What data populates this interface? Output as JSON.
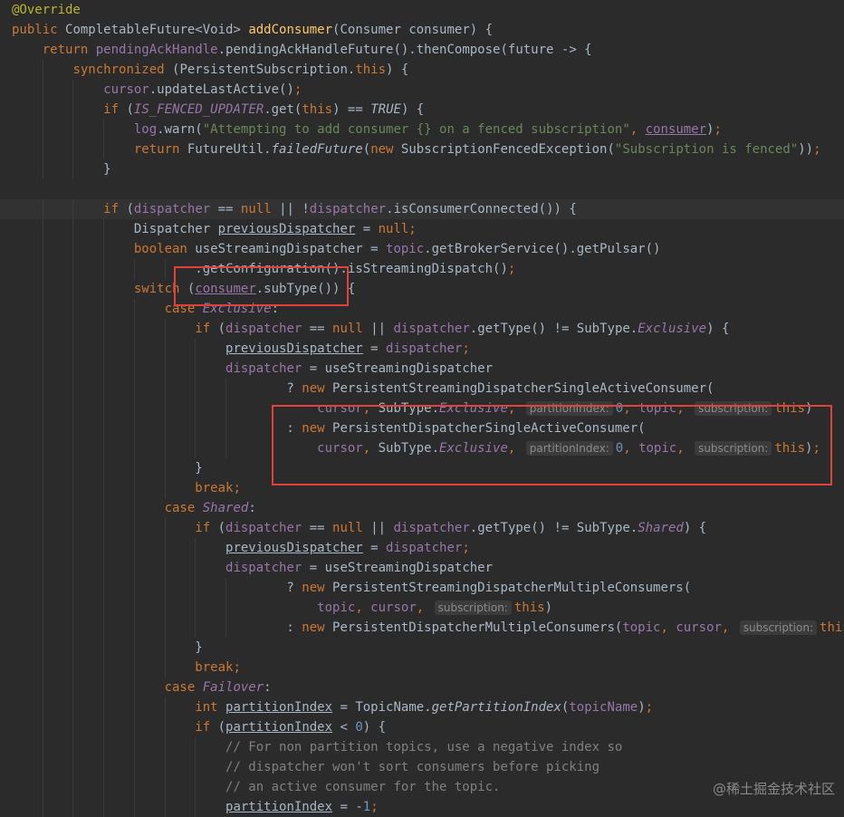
{
  "code_lines": [
    [
      [
        "t-ann",
        "@Override"
      ]
    ],
    [
      [
        "t-kw",
        "public "
      ],
      [
        "tok",
        "CompletableFuture<Void> "
      ],
      [
        "t-fn",
        "addConsumer"
      ],
      [
        "tok",
        "(Consumer consumer) {"
      ]
    ],
    [
      [
        "tok",
        "    "
      ],
      [
        "t-kw",
        "return "
      ],
      [
        "t-field",
        "pendingAckHandle"
      ],
      [
        "tok",
        ".pendingAckHandleFuture().thenCompose(future -> {"
      ]
    ],
    [
      [
        "tok",
        "        "
      ],
      [
        "t-kw",
        "synchronized "
      ],
      [
        "tok",
        "(PersistentSubscription."
      ],
      [
        "t-kw",
        "this"
      ],
      [
        "tok",
        ") {"
      ]
    ],
    [
      [
        "tok",
        "            "
      ],
      [
        "t-field",
        "cursor"
      ],
      [
        "tok",
        ".updateLastActive()"
      ],
      [
        "t-kw",
        ";"
      ]
    ],
    [
      [
        "tok",
        "            "
      ],
      [
        "t-kw",
        "if "
      ],
      [
        "tok",
        "("
      ],
      [
        "t-sfield",
        "IS_FENCED_UPDATER"
      ],
      [
        "tok",
        ".get("
      ],
      [
        "t-kw",
        "this"
      ],
      [
        "tok",
        ") == "
      ],
      [
        "t-italic",
        "TRUE"
      ],
      [
        "tok",
        ") {"
      ]
    ],
    [
      [
        "tok",
        "                "
      ],
      [
        "t-field",
        "log"
      ],
      [
        "tok",
        ".warn("
      ],
      [
        "t-str",
        "\"Attempting to add consumer {} on a fenced subscription\""
      ],
      [
        "t-kw",
        ", "
      ],
      [
        "t-ulf",
        "consumer"
      ],
      [
        "tok",
        ")"
      ],
      [
        "t-kw",
        ";"
      ]
    ],
    [
      [
        "tok",
        "                "
      ],
      [
        "t-kw",
        "return "
      ],
      [
        "tok",
        "FutureUtil."
      ],
      [
        "t-italic",
        "failedFuture"
      ],
      [
        "tok",
        "("
      ],
      [
        "t-kw",
        "new "
      ],
      [
        "tok",
        "SubscriptionFencedException("
      ],
      [
        "t-str",
        "\"Subscription is fenced\""
      ],
      [
        "tok",
        "))"
      ],
      [
        "t-kw",
        ";"
      ]
    ],
    [
      [
        "tok",
        "            }"
      ]
    ],
    [],
    [
      [
        "tok",
        "            "
      ],
      [
        "t-kw",
        "if "
      ],
      [
        "tok",
        "("
      ],
      [
        "t-field",
        "dispatcher"
      ],
      [
        "tok",
        " == "
      ],
      [
        "t-kw",
        "null "
      ],
      [
        "tok",
        "|| !"
      ],
      [
        "t-field",
        "dispatcher"
      ],
      [
        "tok",
        ".isConsumerConnected()) {"
      ]
    ],
    [
      [
        "tok",
        "                Dispatcher "
      ],
      [
        "t-ul",
        "previousDispatcher"
      ],
      [
        "tok",
        " = "
      ],
      [
        "t-kw",
        "null;"
      ]
    ],
    [
      [
        "tok",
        "                "
      ],
      [
        "t-kw",
        "boolean "
      ],
      [
        "tok",
        "useStreamingDispatcher = "
      ],
      [
        "t-field",
        "topic"
      ],
      [
        "tok",
        ".getBrokerService().getPulsar()"
      ]
    ],
    [
      [
        "tok",
        "                        .getConfiguration().isStreamingDispatch()"
      ],
      [
        "t-kw",
        ";"
      ]
    ],
    [
      [
        "tok",
        "                "
      ],
      [
        "t-kw",
        "switch "
      ],
      [
        "tok",
        "("
      ],
      [
        "t-ulf",
        "consumer"
      ],
      [
        "tok",
        ".subType()) {"
      ]
    ],
    [
      [
        "tok",
        "                    "
      ],
      [
        "t-kw",
        "case "
      ],
      [
        "t-enum",
        "Exclusive"
      ],
      [
        "tok",
        ":"
      ]
    ],
    [
      [
        "tok",
        "                        "
      ],
      [
        "t-kw",
        "if "
      ],
      [
        "tok",
        "("
      ],
      [
        "t-field",
        "dispatcher"
      ],
      [
        "tok",
        " == "
      ],
      [
        "t-kw",
        "null "
      ],
      [
        "tok",
        "|| "
      ],
      [
        "t-field",
        "dispatcher"
      ],
      [
        "tok",
        ".getType() != SubType."
      ],
      [
        "t-enum",
        "Exclusive"
      ],
      [
        "tok",
        ") {"
      ]
    ],
    [
      [
        "tok",
        "                            "
      ],
      [
        "t-ul",
        "previousDispatcher"
      ],
      [
        "tok",
        " = "
      ],
      [
        "t-field",
        "dispatcher"
      ],
      [
        "t-kw",
        ";"
      ]
    ],
    [
      [
        "tok",
        "                            "
      ],
      [
        "t-field",
        "dispatcher"
      ],
      [
        "tok",
        " = useStreamingDispatcher"
      ]
    ],
    [
      [
        "tok",
        "                                    ? "
      ],
      [
        "t-kw",
        "new "
      ],
      [
        "tok",
        "PersistentStreamingDispatcherSingleActiveConsumer("
      ]
    ],
    [
      [
        "tok",
        "                                        "
      ],
      [
        "t-field",
        "cursor"
      ],
      [
        "t-kw",
        ", "
      ],
      [
        "tok",
        "SubType."
      ],
      [
        "t-enum",
        "Exclusive"
      ],
      [
        "t-kw",
        ", "
      ],
      [
        "t-hint",
        "partitionIndex:"
      ],
      [
        "t-num",
        "0"
      ],
      [
        "t-kw",
        ", "
      ],
      [
        "t-field",
        "topic"
      ],
      [
        "t-kw",
        ", "
      ],
      [
        "t-hint",
        "subscription:"
      ],
      [
        "t-kw",
        "this"
      ],
      [
        "tok",
        ")"
      ]
    ],
    [
      [
        "tok",
        "                                    : "
      ],
      [
        "t-kw",
        "new "
      ],
      [
        "tok",
        "PersistentDispatcherSingleActiveConsumer("
      ]
    ],
    [
      [
        "tok",
        "                                        "
      ],
      [
        "t-field",
        "cursor"
      ],
      [
        "t-kw",
        ", "
      ],
      [
        "tok",
        "SubType."
      ],
      [
        "t-enum",
        "Exclusive"
      ],
      [
        "t-kw",
        ", "
      ],
      [
        "t-hint",
        "partitionIndex:"
      ],
      [
        "t-num",
        "0"
      ],
      [
        "t-kw",
        ", "
      ],
      [
        "t-field",
        "topic"
      ],
      [
        "t-kw",
        ", "
      ],
      [
        "t-hint",
        "subscription:"
      ],
      [
        "t-kw",
        "this"
      ],
      [
        "tok",
        ")"
      ],
      [
        "t-kw",
        ";"
      ]
    ],
    [
      [
        "tok",
        "                        }"
      ]
    ],
    [
      [
        "tok",
        "                        "
      ],
      [
        "t-kw",
        "break;"
      ]
    ],
    [
      [
        "tok",
        "                    "
      ],
      [
        "t-kw",
        "case "
      ],
      [
        "t-enum",
        "Shared"
      ],
      [
        "tok",
        ":"
      ]
    ],
    [
      [
        "tok",
        "                        "
      ],
      [
        "t-kw",
        "if "
      ],
      [
        "tok",
        "("
      ],
      [
        "t-field",
        "dispatcher"
      ],
      [
        "tok",
        " == "
      ],
      [
        "t-kw",
        "null "
      ],
      [
        "tok",
        "|| "
      ],
      [
        "t-field",
        "dispatcher"
      ],
      [
        "tok",
        ".getType() != SubType."
      ],
      [
        "t-enum",
        "Shared"
      ],
      [
        "tok",
        ") {"
      ]
    ],
    [
      [
        "tok",
        "                            "
      ],
      [
        "t-ul",
        "previousDispatcher"
      ],
      [
        "tok",
        " = "
      ],
      [
        "t-field",
        "dispatcher"
      ],
      [
        "t-kw",
        ";"
      ]
    ],
    [
      [
        "tok",
        "                            "
      ],
      [
        "t-field",
        "dispatcher"
      ],
      [
        "tok",
        " = useStreamingDispatcher"
      ]
    ],
    [
      [
        "tok",
        "                                    ? "
      ],
      [
        "t-kw",
        "new "
      ],
      [
        "tok",
        "PersistentStreamingDispatcherMultipleConsumers("
      ]
    ],
    [
      [
        "tok",
        "                                        "
      ],
      [
        "t-field",
        "topic"
      ],
      [
        "t-kw",
        ", "
      ],
      [
        "t-field",
        "cursor"
      ],
      [
        "t-kw",
        ", "
      ],
      [
        "t-hint",
        "subscription:"
      ],
      [
        "t-kw",
        "this"
      ],
      [
        "tok",
        ")"
      ]
    ],
    [
      [
        "tok",
        "                                    : "
      ],
      [
        "t-kw",
        "new "
      ],
      [
        "tok",
        "PersistentDispatcherMultipleConsumers("
      ],
      [
        "t-field",
        "topic"
      ],
      [
        "t-kw",
        ", "
      ],
      [
        "t-field",
        "cursor"
      ],
      [
        "t-kw",
        ", "
      ],
      [
        "t-hint",
        "subscription:"
      ],
      [
        "t-kw",
        "this"
      ],
      [
        "tok",
        ")"
      ],
      [
        "t-kw",
        ";"
      ]
    ],
    [
      [
        "tok",
        "                        }"
      ]
    ],
    [
      [
        "tok",
        "                        "
      ],
      [
        "t-kw",
        "break;"
      ]
    ],
    [
      [
        "tok",
        "                    "
      ],
      [
        "t-kw",
        "case "
      ],
      [
        "t-enum",
        "Failover"
      ],
      [
        "tok",
        ":"
      ]
    ],
    [
      [
        "tok",
        "                        "
      ],
      [
        "t-kw",
        "int "
      ],
      [
        "t-ul",
        "partitionIndex"
      ],
      [
        "tok",
        " = TopicName."
      ],
      [
        "t-italic",
        "getPartitionIndex"
      ],
      [
        "tok",
        "("
      ],
      [
        "t-field",
        "topicName"
      ],
      [
        "tok",
        ")"
      ],
      [
        "t-kw",
        ";"
      ]
    ],
    [
      [
        "tok",
        "                        "
      ],
      [
        "t-kw",
        "if "
      ],
      [
        "tok",
        "("
      ],
      [
        "t-ul",
        "partitionIndex"
      ],
      [
        "tok",
        " < "
      ],
      [
        "t-num",
        "0"
      ],
      [
        "tok",
        ") {"
      ]
    ],
    [
      [
        "tok",
        "                            "
      ],
      [
        "t-cmt",
        "// For non partition topics, use a negative index so"
      ]
    ],
    [
      [
        "tok",
        "                            "
      ],
      [
        "t-cmt",
        "// dispatcher won't sort consumers before picking"
      ]
    ],
    [
      [
        "tok",
        "                            "
      ],
      [
        "t-cmt",
        "// an active consumer for the topic."
      ]
    ],
    [
      [
        "tok",
        "                            "
      ],
      [
        "t-ul",
        "partitionIndex"
      ],
      [
        "tok",
        " = -"
      ],
      [
        "t-num",
        "1"
      ],
      [
        "t-kw",
        ";"
      ]
    ]
  ],
  "guide_columns": [
    4,
    8,
    12,
    16,
    20,
    24,
    28
  ],
  "highlight_lines": [
    10
  ],
  "watermark": "@稀土掘金技术社区"
}
